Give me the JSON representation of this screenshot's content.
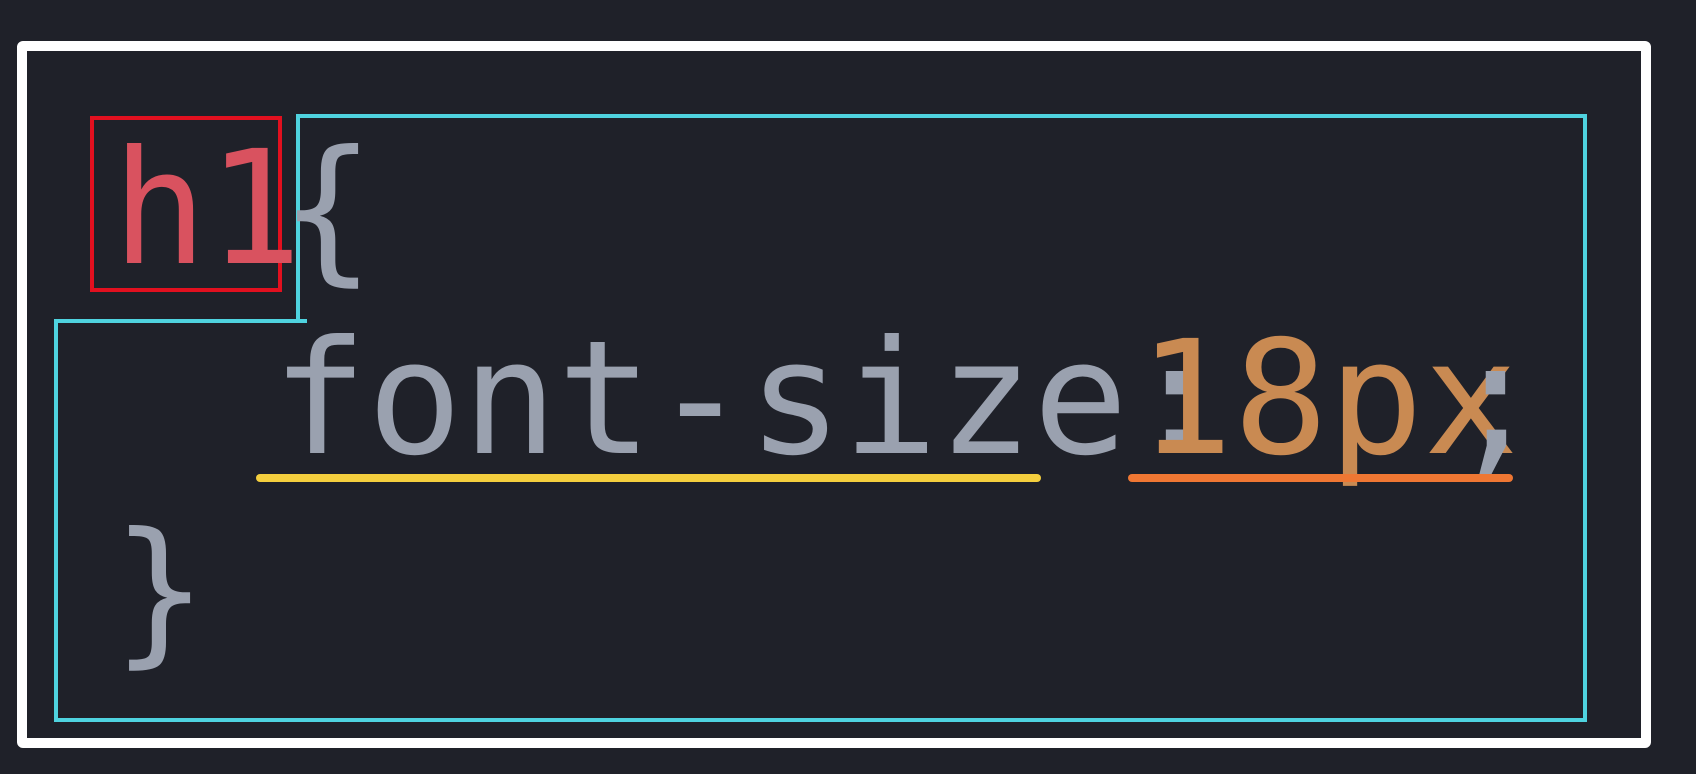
{
  "code": {
    "selector": "h1",
    "open_brace": "{",
    "property": "font-size:",
    "value": "18px",
    "semicolon": ";",
    "close_brace": "}"
  },
  "colors": {
    "background": "#1f2129",
    "selector_text": "#d9525f",
    "punctuation_text": "#9aa1af",
    "value_text": "#c98a52",
    "outer_frame": "#ffffff",
    "selector_highlight": "#e2101f",
    "rule_block_outline": "#4fd3df",
    "property_underline": "#f4cf3e",
    "value_underline": "#ef7733"
  }
}
